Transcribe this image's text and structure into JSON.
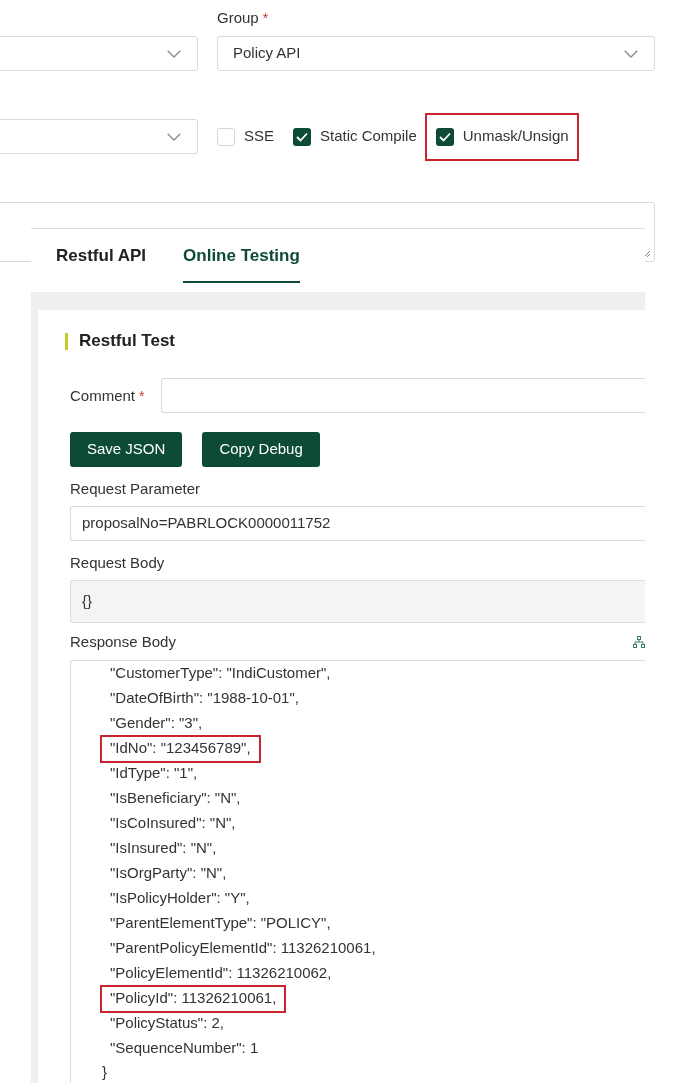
{
  "form": {
    "group": {
      "label": "Group",
      "required_mark": "*",
      "value": "Policy API"
    },
    "options": [
      {
        "label": "SSE",
        "checked": false,
        "highlighted": false
      },
      {
        "label": "Static Compile",
        "checked": true,
        "highlighted": false
      },
      {
        "label": "Unmask/Unsign",
        "checked": true,
        "highlighted": true
      }
    ]
  },
  "tabs": [
    {
      "label": "Restful API",
      "selected": false
    },
    {
      "label": "Online Testing",
      "selected": true
    }
  ],
  "restful_test": {
    "title": "Restful Test",
    "comment": {
      "label": "Comment",
      "required_mark": "*"
    },
    "buttons": [
      "Save JSON",
      "Copy Debug"
    ],
    "request_parameter": {
      "label": "Request Parameter",
      "value": "proposalNo=PABRLOCK0000011752"
    },
    "request_body": {
      "label": "Request Body",
      "value": "{}"
    },
    "response_body": {
      "label": "Response Body",
      "lines": [
        {
          "text": "\"CustomerType\": \"IndiCustomer\",",
          "highlighted": false
        },
        {
          "text": "\"DateOfBirth\": \"1988-10-01\",",
          "highlighted": false
        },
        {
          "text": "\"Gender\": \"3\",",
          "highlighted": false
        },
        {
          "text": "\"IdNo\": \"123456789\",",
          "highlighted": true
        },
        {
          "text": "\"IdType\": \"1\",",
          "highlighted": false
        },
        {
          "text": "\"IsBeneficiary\": \"N\",",
          "highlighted": false
        },
        {
          "text": "\"IsCoInsured\": \"N\",",
          "highlighted": false
        },
        {
          "text": "\"IsInsured\": \"N\",",
          "highlighted": false
        },
        {
          "text": "\"IsOrgParty\": \"N\",",
          "highlighted": false
        },
        {
          "text": "\"IsPolicyHolder\": \"Y\",",
          "highlighted": false
        },
        {
          "text": "\"ParentElementType\": \"POLICY\",",
          "highlighted": false
        },
        {
          "text": "\"ParentPolicyElementId\": 11326210061,",
          "highlighted": false
        },
        {
          "text": "\"PolicyElementId\": 11326210062,",
          "highlighted": false
        },
        {
          "text": "\"PolicyId\": 11326210061,",
          "highlighted": true
        },
        {
          "text": "\"PolicyStatus\": 2,",
          "highlighted": false
        },
        {
          "text": "\"SequenceNumber\": 1",
          "highlighted": false
        }
      ],
      "closing": "}"
    }
  }
}
